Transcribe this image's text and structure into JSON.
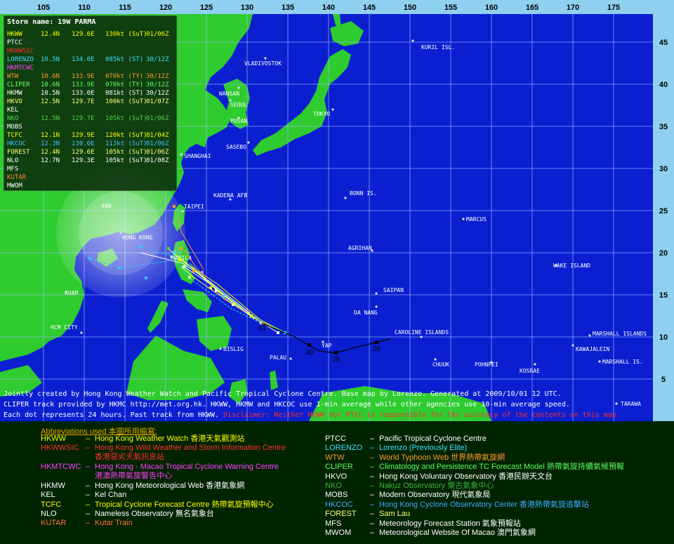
{
  "map": {
    "lon_labels": [
      "105",
      "110",
      "115",
      "120",
      "125",
      "130",
      "135",
      "140",
      "145",
      "150",
      "155",
      "160",
      "165",
      "170",
      "175"
    ],
    "lat_labels": [
      "45",
      "40",
      "35",
      "30",
      "25",
      "20",
      "15",
      "10",
      "5"
    ],
    "circle_label": "400",
    "places": [
      {
        "name": "KURIL ISL.",
        "style": "light"
      },
      {
        "name": "VLADIVOSTOK",
        "style": "light"
      },
      {
        "name": "WANSAN",
        "style": "light"
      },
      {
        "name": "SEOUL",
        "style": "light"
      },
      {
        "name": "TOKYO",
        "style": "light"
      },
      {
        "name": "PUSAN",
        "style": "light"
      },
      {
        "name": "SASEBO",
        "style": "light"
      },
      {
        "name": "SHANGHAI",
        "style": "light"
      },
      {
        "name": "BONN IS.",
        "style": "light"
      },
      {
        "name": "KADENA AFB",
        "style": "light"
      },
      {
        "name": "TAIPEI",
        "style": "light"
      },
      {
        "name": "MARCUS",
        "style": "light"
      },
      {
        "name": "HONG KONG",
        "style": "light"
      },
      {
        "name": "AGRIHAN",
        "style": "light"
      },
      {
        "name": "WAKE ISLAND",
        "style": "light"
      },
      {
        "name": "MANILA",
        "style": "light"
      },
      {
        "name": "SAIPAN",
        "style": "light"
      },
      {
        "name": "DA NANG",
        "style": "light"
      },
      {
        "name": "GUAM",
        "style": "light"
      },
      {
        "name": "HCM CITY",
        "style": "light"
      },
      {
        "name": "CAROLINE ISLANDS",
        "style": "light"
      },
      {
        "name": "MARSHALL ISLANDS",
        "style": "light"
      },
      {
        "name": "KAWAJALEIN",
        "style": "light"
      },
      {
        "name": "BISLIG",
        "style": "light"
      },
      {
        "name": "YAP",
        "style": "light"
      },
      {
        "name": "PALAU",
        "style": "light"
      },
      {
        "name": "CHUUK",
        "style": "light"
      },
      {
        "name": "POHNPEI",
        "style": "light"
      },
      {
        "name": "MARSHALL IS.",
        "style": "light"
      },
      {
        "name": "KOSRAE",
        "style": "light"
      },
      {
        "name": "TARAWA",
        "style": "light"
      }
    ],
    "past_track_labels": [
      "28",
      "29",
      "30",
      "01"
    ]
  },
  "storm": {
    "title": "Storm name: 19W PARMA",
    "agencies": [
      {
        "code": "HKWW",
        "lat": "12.4N",
        "lon": "129.6E",
        "intensity": "130kt (SuT)",
        "time": "01/06Z",
        "color": "#ffff00"
      },
      {
        "code": "PTCC",
        "lat": "",
        "lon": "",
        "intensity": "",
        "time": "",
        "color": "#ffffff"
      },
      {
        "code": "HKWWSIC",
        "lat": "",
        "lon": "",
        "intensity": "",
        "time": "",
        "color": "#ff3030"
      },
      {
        "code": "LORENZO",
        "lat": "10.5N",
        "lon": "134.0E",
        "intensity": "085kt (ST)",
        "time": "30/12Z",
        "color": "#40e0ff"
      },
      {
        "code": "HKMTCWC",
        "lat": "",
        "lon": "",
        "intensity": "",
        "time": "",
        "color": "#ff40ff"
      },
      {
        "code": "WTW",
        "lat": "10.6N",
        "lon": "133.9E",
        "intensity": "070kt (TY)",
        "time": "30/12Z",
        "color": "#ff9a30"
      },
      {
        "code": "CLIPER",
        "lat": "10.6N",
        "lon": "133.9E",
        "intensity": "070kt (TY)",
        "time": "30/12Z",
        "color": "#60ff60"
      },
      {
        "code": "HKMW",
        "lat": "10.5N",
        "lon": "133.0E",
        "intensity": "081kt (ST)",
        "time": "30/12Z",
        "color": "#ffffff"
      },
      {
        "code": "HKVO",
        "lat": "12.5N",
        "lon": "129.7E",
        "intensity": "100kt (SuT)",
        "time": "01/07Z",
        "color": "#ffff80"
      },
      {
        "code": "KEL",
        "lat": "",
        "lon": "",
        "intensity": "",
        "time": "",
        "color": "#ffffff"
      },
      {
        "code": "NKO",
        "lat": "12.5N",
        "lon": "129.7E",
        "intensity": "105kt (SuT)",
        "time": "01/06Z",
        "color": "#50d050"
      },
      {
        "code": "MOBS",
        "lat": "",
        "lon": "",
        "intensity": "",
        "time": "",
        "color": "#ffffff"
      },
      {
        "code": "TCFC",
        "lat": "12.1N",
        "lon": "129.9E",
        "intensity": "120kt (SuT)",
        "time": "01/04Z",
        "color": "#ffff00"
      },
      {
        "code": "HKCOC",
        "lat": "12.3N",
        "lon": "130.0E",
        "intensity": "113kt (SuT)",
        "time": "01/06Z",
        "color": "#40c0ff"
      },
      {
        "code": "FOREST",
        "lat": "12.4N",
        "lon": "129.6E",
        "intensity": "105kt (SuT)",
        "time": "01/06Z",
        "color": "#ffff80"
      },
      {
        "code": "NLO",
        "lat": "12.7N",
        "lon": "129.3E",
        "intensity": "105kt (SuT)",
        "time": "01/08Z",
        "color": "#ffffff"
      },
      {
        "code": "MFS",
        "lat": "",
        "lon": "",
        "intensity": "",
        "time": "",
        "color": "#ffffff"
      },
      {
        "code": "KUTAR",
        "lat": "",
        "lon": "",
        "intensity": "",
        "time": "",
        "color": "#ff8040"
      },
      {
        "code": "MWOM",
        "lat": "",
        "lon": "",
        "intensity": "",
        "time": "",
        "color": "#ffffff"
      }
    ]
  },
  "footer": {
    "line1": "Jointly created by Hong Kong Weather Watch and Pacific Tropical Cyclone Centre. Base map by Lorenzo. Generated at 2009/10/01 12 UTC.",
    "line2": "CLIPER track provided by HKMC http://met.org.hk. HKWW, HKMW and HKCOC use 1-min average while other agencies use 10-min average speed.",
    "line3_a": "Each dot represents 24 hours. Past track from HKWW. ",
    "line3_b": "Disclaimer: Neither HKWW nor PTCC is responsible for the accuracy of the contents on this map."
  },
  "abbreviations": {
    "title": "Abbreviations used 本圖所用縮寫:",
    "dash": "–",
    "left": [
      {
        "code": "HKWW",
        "desc": "Hong Kong Weather Watch 香港天氣觀測站",
        "desc2": "",
        "color": "#ffff00"
      },
      {
        "code": "HKWWSIC",
        "desc": "Hong Kong Wild Weather and Storm Information Centre",
        "desc2": "香港惡劣天氣訊息站",
        "color": "#ff3030"
      },
      {
        "code": "HKMTCWC",
        "desc": "Hong Kong - Macao Tropical Cyclone Warning Centre",
        "desc2": "港澳熱帶氣旋警告中心",
        "color": "#ff40ff"
      },
      {
        "code": "HKMW",
        "desc": "Hong Kong Meteorological Web 香港氣象網",
        "desc2": "",
        "color": "#ffffff"
      },
      {
        "code": "KEL",
        "desc": "Kel Chan",
        "desc2": "",
        "color": "#ffffff"
      },
      {
        "code": "TCFC",
        "desc": "Tropical Cyclone Forecast Centre 熱帶氣旋預報中心",
        "desc2": "",
        "color": "#ffff00"
      },
      {
        "code": "NLO",
        "desc": "Nameless Observatory 無名氣象台",
        "desc2": "",
        "color": "#ffffff"
      },
      {
        "code": "KUTAR",
        "desc": "Kutar Train",
        "desc2": "",
        "color": "#ff7040"
      }
    ],
    "right": [
      {
        "code": "PTCC",
        "desc": "Pacific Tropical Cyclone Centre",
        "color": "#ffffff"
      },
      {
        "code": "LORENZO",
        "desc": "Lorenzo (Previously Elite)",
        "color": "#40e0ff"
      },
      {
        "code": "WTW",
        "desc": "World Typhoon Web 世界熱帶氣旋網",
        "color": "#ff9a30"
      },
      {
        "code": "CLIPER",
        "desc": "Climatology and Persistence TC Forecast Model 熱帶氣旋持續氣候預報",
        "color": "#60ff60"
      },
      {
        "code": "HKVO",
        "desc": "Hong Kong Voluntary Observatory 香港民辦天文台",
        "color": "#ffffff"
      },
      {
        "code": "NKO",
        "desc": "Nakuz Observatory 樂古氣象中心",
        "color": "#40b040"
      },
      {
        "code": "MOBS",
        "desc": "Modern Observatory 現代氣象局",
        "color": "#ffffff"
      },
      {
        "code": "HKCOC",
        "desc": "Hong Kong Cyclone Observatory Center 香港熱帶氣旋追擊站",
        "color": "#40a8ff"
      },
      {
        "code": "FOREST",
        "desc": "Sam Lau",
        "color": "#ffff80"
      },
      {
        "code": "MFS",
        "desc": "Meteorology Forecast Station 氣象預報站",
        "color": "#ffffff"
      },
      {
        "code": "MWOM",
        "desc": "Meteorological Website Of Macao 澳門氣象網",
        "color": "#ffffff"
      }
    ]
  }
}
